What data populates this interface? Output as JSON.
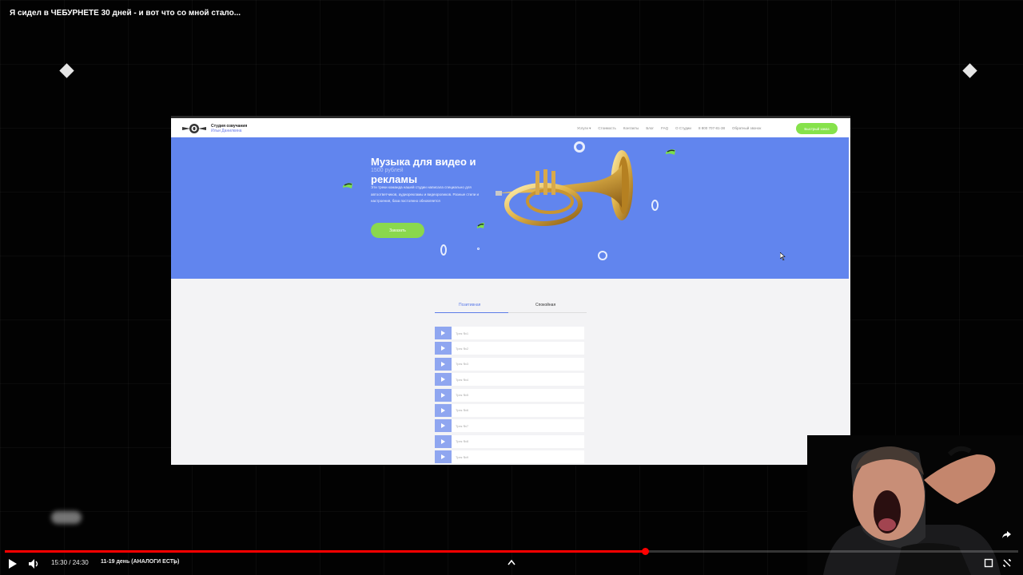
{
  "video": {
    "title": "Я сидел в ЧЕБУРНЕТЕ 30 дней - и вот что со мной стало...",
    "time": "15:30 / 24:30",
    "chapter": "11-19 день (АНАЛОГИ ЕСТЬ)",
    "chapter_arrow": "›",
    "progress": 0.632,
    "buffered": 0.665,
    "accent_color": "#ff0000"
  },
  "site": {
    "logo_line1": "Студия озвучания",
    "logo_line2": "Ильи Данилкина",
    "nav": [
      "Услуги ▾",
      "Стоимость",
      "Контакты",
      "Блог",
      "FAQ",
      "О Студии",
      "8 800 707-81-38",
      "Обратный звонок"
    ],
    "cta_top": "Быстрый заказ",
    "hero": {
      "title": "Музыка для видео и рекламы",
      "ghost": "1500 рублей",
      "description": "Эти треки команда нашей студии написала специально для автоответчиков, аудиорекламы и видеороликов. Разные стили и настроения, база постоянно обновляется",
      "button": "Заказать",
      "background": "#6185ee"
    },
    "tabs": [
      "Позитивная",
      "Спокойная"
    ],
    "tracks": [
      "Трек №1",
      "Трек №2",
      "Трек №3",
      "Трек №4",
      "Трек №5",
      "Трек №6",
      "Трек №7",
      "Трек №8",
      "Трек №9"
    ]
  },
  "icons": {
    "play": "play-icon",
    "volume": "volume-icon",
    "chevron_up": "chevron-up-icon",
    "share": "share-icon",
    "miniplayer": "miniplayer-icon",
    "fullscreen": "exit-fullscreen-icon"
  }
}
